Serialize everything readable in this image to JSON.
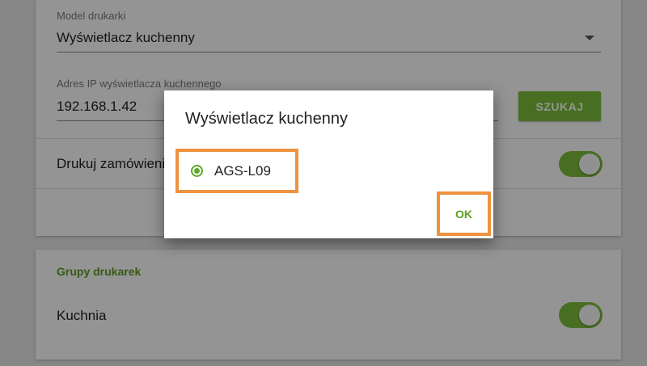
{
  "settings": {
    "printer_model_label": "Model drukarki",
    "printer_model_value": "Wyświetlacz kuchenny",
    "ip_label": "Adres IP wyświetlacza kuchennego",
    "ip_value": "192.168.1.42",
    "search_button": "SZUKAJ",
    "print_orders_label": "Drukuj zamówienia",
    "print_orders_on": true
  },
  "printer_groups": {
    "title": "Grupy drukarek",
    "items": [
      {
        "label": "Kuchnia",
        "enabled": true
      }
    ]
  },
  "dialog": {
    "title": "Wyświetlacz kuchenny",
    "options": [
      {
        "label": "AGS-L09",
        "selected": true
      }
    ],
    "ok_button": "OK"
  },
  "colors": {
    "accent": "#7cbd3a",
    "accent_text": "#5c9e22",
    "highlight": "#ef923f"
  }
}
